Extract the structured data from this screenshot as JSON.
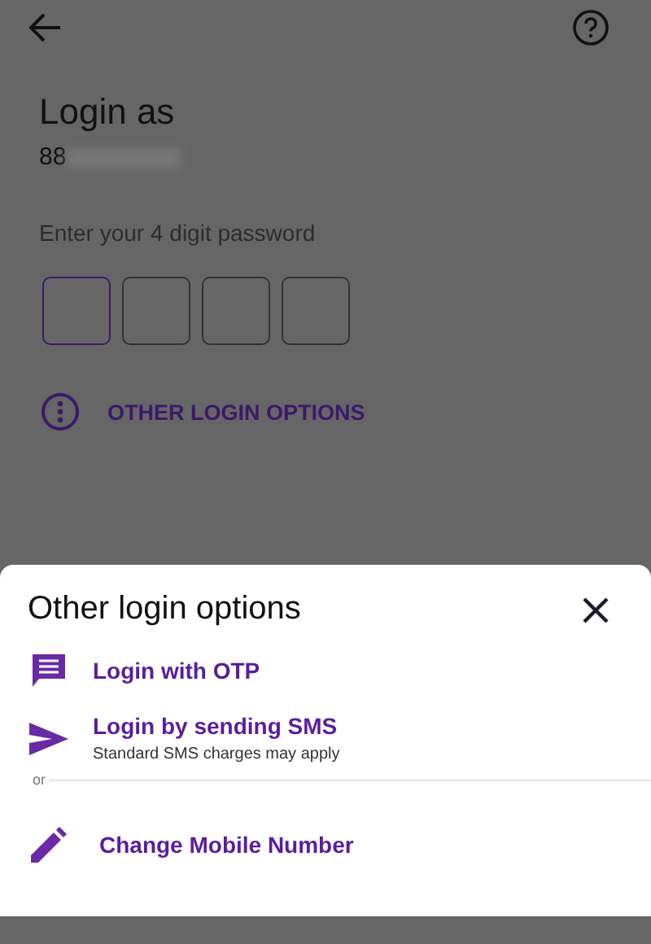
{
  "screen": {
    "title": "Login as",
    "phone": "88",
    "password_label": "Enter your 4 digit password",
    "pin_boxes": [
      {
        "focused": true
      },
      {
        "focused": false
      },
      {
        "focused": false
      },
      {
        "focused": false
      }
    ],
    "other_options_link": "OTHER LOGIN OPTIONS"
  },
  "sheet": {
    "title": "Other login options",
    "items": [
      {
        "kind": "chat",
        "label": "Login with OTP"
      },
      {
        "kind": "send",
        "label": "Login by sending SMS",
        "note": "Standard SMS charges may apply"
      },
      {
        "kind": "separator",
        "label": "or"
      },
      {
        "kind": "edit",
        "label": "Change Mobile Number"
      }
    ]
  }
}
